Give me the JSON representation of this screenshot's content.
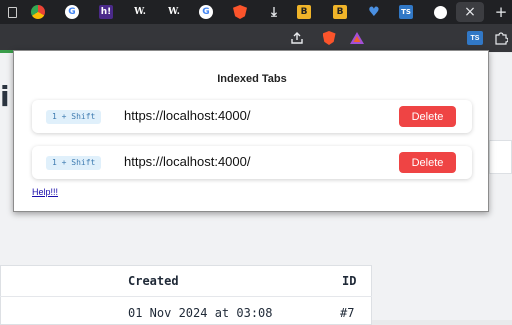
{
  "browser": {
    "tabs": [
      {
        "icon": "bookmark-icon",
        "label": ""
      },
      {
        "icon": "chrome-icon",
        "label": ""
      },
      {
        "icon": "google-icon",
        "label": "G"
      },
      {
        "icon": "h-site-icon",
        "label": "h!"
      },
      {
        "icon": "wikipedia-icon",
        "label": "W."
      },
      {
        "icon": "wikipedia-icon",
        "label": "W."
      },
      {
        "icon": "google-icon",
        "label": "G"
      },
      {
        "icon": "brave-icon",
        "label": ""
      },
      {
        "icon": "download-icon",
        "label": ""
      },
      {
        "icon": "b-site-icon",
        "label": "B"
      },
      {
        "icon": "b-site-icon",
        "label": "B"
      },
      {
        "icon": "heart-icon",
        "label": ""
      },
      {
        "icon": "ts-icon",
        "label": "TS"
      },
      {
        "icon": "github-icon",
        "label": ""
      }
    ],
    "close_tab": "×",
    "new_tab": "+",
    "extension_label": "TS"
  },
  "popup": {
    "title": "Indexed Tabs",
    "items": [
      {
        "shortcut": "1 + Shift",
        "url": "https://localhost:4000/",
        "delete_label": "Delete"
      },
      {
        "shortcut": "1 + Shift",
        "url": "https://localhost:4000/",
        "delete_label": "Delete"
      }
    ],
    "help_link": "Help!!!"
  },
  "page": {
    "heading_fragment": "i",
    "table": {
      "headers": {
        "created": "Created",
        "id": "ID"
      },
      "row": {
        "created": "01 Nov 2024 at 03:08",
        "id": "#7"
      }
    }
  },
  "colors": {
    "delete": "#ef4444",
    "shortcut_bg": "#e0f0fb",
    "tabstrip": "#202124",
    "toolbar": "#35363a"
  }
}
